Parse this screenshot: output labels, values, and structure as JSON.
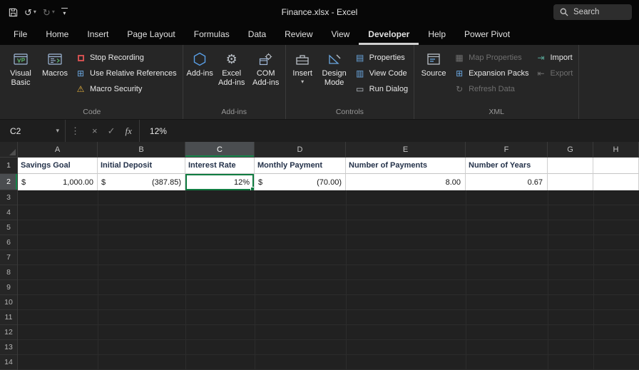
{
  "titlebar": {
    "title": "Finance.xlsx  -  Excel",
    "search_label": "Search"
  },
  "tabs": [
    {
      "label": "File"
    },
    {
      "label": "Home"
    },
    {
      "label": "Insert"
    },
    {
      "label": "Page Layout"
    },
    {
      "label": "Formulas"
    },
    {
      "label": "Data"
    },
    {
      "label": "Review"
    },
    {
      "label": "View"
    },
    {
      "label": "Developer",
      "active": true
    },
    {
      "label": "Help"
    },
    {
      "label": "Power Pivot"
    }
  ],
  "ribbon": {
    "code": {
      "visual_basic": "Visual Basic",
      "macros": "Macros",
      "stop_recording": "Stop Recording",
      "use_relative_references": "Use Relative References",
      "macro_security": "Macro Security",
      "group_label": "Code"
    },
    "addins": {
      "add_ins": "Add-ins",
      "excel_add_ins": "Excel Add-ins",
      "com_add_ins": "COM Add-ins",
      "group_label": "Add-ins"
    },
    "controls": {
      "insert": "Insert",
      "design_mode": "Design Mode",
      "properties": "Properties",
      "view_code": "View Code",
      "run_dialog": "Run Dialog",
      "group_label": "Controls"
    },
    "xml": {
      "source": "Source",
      "map_properties": "Map Properties",
      "expansion_packs": "Expansion Packs",
      "refresh_data": "Refresh Data",
      "import": "Import",
      "export": "Export",
      "group_label": "XML"
    }
  },
  "formula_bar": {
    "name_box": "C2",
    "formula": "12%"
  },
  "icons": {
    "caret": "▾",
    "dots": "⋮",
    "cancel": "×",
    "check": "✓",
    "fx": "fx",
    "undo": "↺",
    "redo": "↻",
    "grid": "⊞",
    "warning": "⚠",
    "gear": "⚙",
    "properties": "▤",
    "view_code": "▥",
    "run_dialog": "▭",
    "map_properties": "▦",
    "expansion_packs": "⊞",
    "refresh": "↻",
    "import": "⇥",
    "export": "⇤"
  },
  "sheet": {
    "columns": [
      "A",
      "B",
      "C",
      "D",
      "E",
      "F",
      "G",
      "H"
    ],
    "row_numbers": [
      "1",
      "2",
      "3",
      "4",
      "5",
      "6",
      "7",
      "8",
      "9",
      "10",
      "11",
      "12",
      "13",
      "14"
    ],
    "selected_cell": "C2",
    "header_row": [
      "Savings Goal",
      "Initial Deposit",
      "Interest Rate",
      "Monthly Payment",
      "Number of Payments",
      "Number of Years"
    ],
    "data_row": {
      "a_symbol": "$",
      "a_value": "1,000.00",
      "b_symbol": "$",
      "b_value": "(387.85)",
      "c_value": "12%",
      "d_symbol": "$",
      "d_value": "(70.00)",
      "e_value": "8.00",
      "f_value": "0.67"
    }
  }
}
